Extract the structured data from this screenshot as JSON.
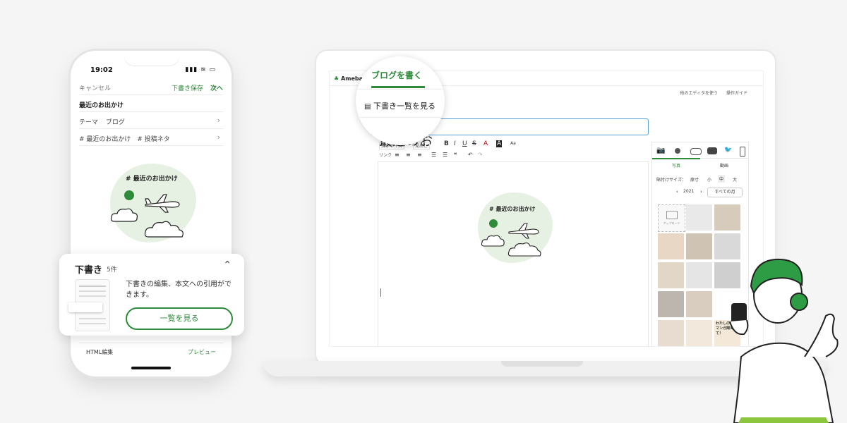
{
  "phone": {
    "time": "19:02",
    "status_icons": "▮▮▮ ≋ ▭",
    "cancel": "キャンセル",
    "save_draft": "下書き保存",
    "next": "次へ",
    "post_title": "最近のお出かけ",
    "theme_label": "テーマ",
    "theme_value": "ブログ",
    "hashtags": "# 最近のお出かけ　# 投稿ネタ",
    "illustration_title": "# 最近のお出かけ",
    "html_edit": "HTML編集",
    "preview": "プレビュー"
  },
  "draft_card": {
    "title": "下書き",
    "count": "5件",
    "description": "下書きの編集、本文への引用ができます。",
    "button": "一覧を見る"
  },
  "magnifier": {
    "tab": "ブログを書く",
    "drafts_link": "下書き一覧を見る"
  },
  "editor": {
    "logo": "Ameba",
    "other_editor": "他のエディタを使う",
    "guide": "操作ガイド",
    "title_partial": "最近のお",
    "illustration_title": "# 最近のお出かけ",
    "toolbar": {
      "text_size": "文字サイズ",
      "heading": "見出し",
      "link": "リンク"
    },
    "panel": {
      "tabs": [
        "写真",
        "動画"
      ],
      "size_label": "貼付けサイズ：",
      "size_options": [
        "原寸",
        "小",
        "中",
        "大"
      ],
      "year": "2021",
      "month_select": "すべての月",
      "upload": "アップロード",
      "manga_text": "わたしの推しマンガ聞いて！"
    }
  },
  "colors": {
    "accent": "#2e8b3a",
    "blob": "#e6f1e3",
    "hair": "#2e9c45"
  }
}
